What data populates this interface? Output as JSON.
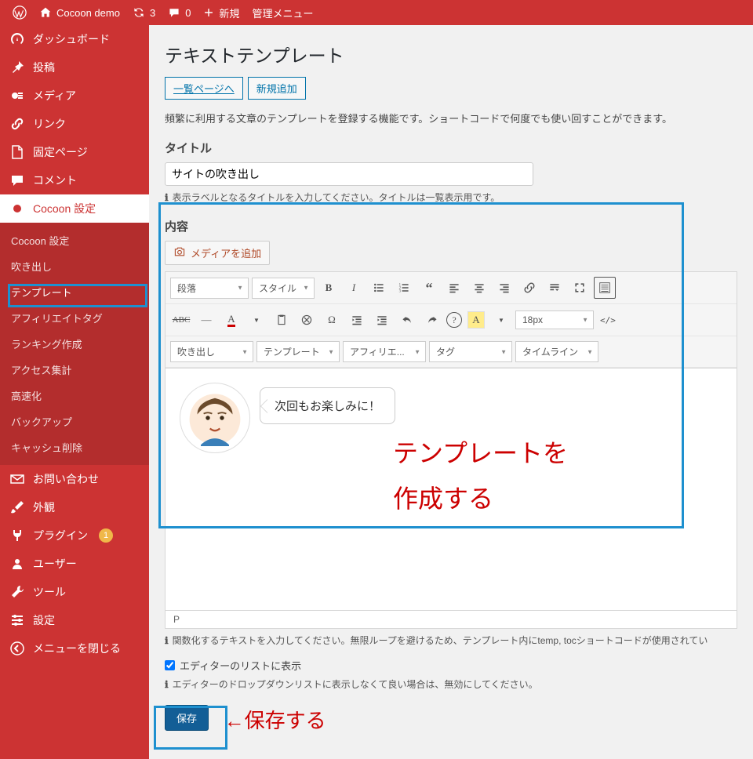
{
  "adminbar": {
    "site_name": "Cocoon demo",
    "updates": "3",
    "comments": "0",
    "new": "新規",
    "admin_menu": "管理メニュー"
  },
  "sidebar": {
    "dashboard": "ダッシュボード",
    "posts": "投稿",
    "media": "メディア",
    "links": "リンク",
    "pages": "固定ページ",
    "comments": "コメント",
    "cocoon_settings": "Cocoon 設定",
    "sub": {
      "cocoon_settings": "Cocoon 設定",
      "speech": "吹き出し",
      "template": "テンプレート",
      "affiliate": "アフィリエイトタグ",
      "ranking": "ランキング作成",
      "access": "アクセス集計",
      "speedup": "高速化",
      "backup": "バックアップ",
      "cache": "キャッシュ削除"
    },
    "contact": "お問い合わせ",
    "appearance": "外観",
    "plugins": "プラグイン",
    "plugin_badge": "1",
    "users": "ユーザー",
    "tools": "ツール",
    "settings": "設定",
    "collapse": "メニューを閉じる"
  },
  "page": {
    "title": "テキストテンプレート",
    "list_link": "一覧ページへ",
    "new_link": "新規追加",
    "desc": "頻繁に利用する文章のテンプレートを登録する機能です。ショートコードで何度でも使い回すことができます。",
    "title_label": "タイトル",
    "title_value": "サイトの吹き出し",
    "title_hint": "表示ラベルとなるタイトルを入力してください。タイトルは一覧表示用です。",
    "content_label": "内容",
    "add_media": "メディアを追加",
    "toolbar": {
      "format": "段落",
      "style": "スタイル",
      "fontsize": "18px",
      "speech": "吹き出し",
      "template": "テンプレート",
      "affiliate": "アフィリエ...",
      "tag": "タグ",
      "timeline": "タイムライン"
    },
    "bubble_text": "次回もお楽しみに！",
    "overlay": "テンプレートを\n作成する",
    "pathbar": "P",
    "content_hint": "関数化するテキストを入力してください。無限ループを避けるため、テンプレート内にtemp, tocショートコードが使用されてい",
    "checkbox_label": "エディターのリストに表示",
    "checkbox_hint": "エディターのドロップダウンリストに表示しなくて良い場合は、無効にしてください。",
    "save": "保存",
    "save_annot": "←保存する"
  }
}
